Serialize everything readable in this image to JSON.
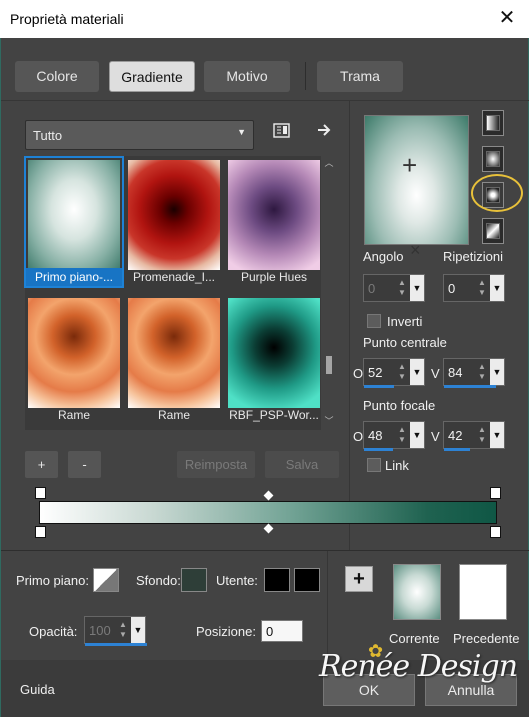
{
  "window": {
    "title": "Proprietà materiali",
    "close_glyph": "✕"
  },
  "tabs": [
    {
      "label": "Colore",
      "active": false
    },
    {
      "label": "Gradiente",
      "active": true
    },
    {
      "label": "Motivo",
      "active": false
    },
    {
      "label": "Trama",
      "active": false
    }
  ],
  "library": {
    "category": "Tutto",
    "items": [
      {
        "label": "Primo piano-...",
        "selected": true
      },
      {
        "label": "Promenade_I...",
        "selected": false
      },
      {
        "label": "Purple Hues",
        "selected": false
      },
      {
        "label": "Rame",
        "selected": false
      },
      {
        "label": "Rame",
        "selected": false
      },
      {
        "label": "RBF_PSP-Wor...",
        "selected": false
      }
    ],
    "add_label": "+",
    "remove_label": "-",
    "reset_label": "Reimposta",
    "save_label": "Salva"
  },
  "gradient_type_buttons": [
    "linear",
    "rectangular",
    "sunburst",
    "radial"
  ],
  "controls": {
    "angle_label": "Angolo",
    "angle_value": "0",
    "repeats_label": "Ripetizioni",
    "repeats_value": "0",
    "invert_label": "Inverti",
    "center_label": "Punto centrale",
    "center_h_prefix": "O",
    "center_h": "52",
    "center_v_prefix": "V",
    "center_v": "84",
    "focal_label": "Punto focale",
    "focal_h_prefix": "O",
    "focal_h": "48",
    "focal_v_prefix": "V",
    "focal_v": "42",
    "link_label": "Link"
  },
  "gradient_bar": {
    "colors": [
      "#ffffff",
      "#0f5745"
    ]
  },
  "materials": {
    "foreground_label": "Primo piano:",
    "background_label": "Sfondo:",
    "user_label": "Utente:",
    "opacity_label": "Opacità:",
    "opacity_value": "100",
    "position_label": "Posizione:",
    "position_value": "0",
    "current_label": "Corrente",
    "previous_label": "Precedente",
    "add_glyph": "+"
  },
  "footer": {
    "help_label": "Guida",
    "ok_label": "OK",
    "cancel_label": "Annulla"
  },
  "watermark": {
    "text": "Renée Design"
  }
}
